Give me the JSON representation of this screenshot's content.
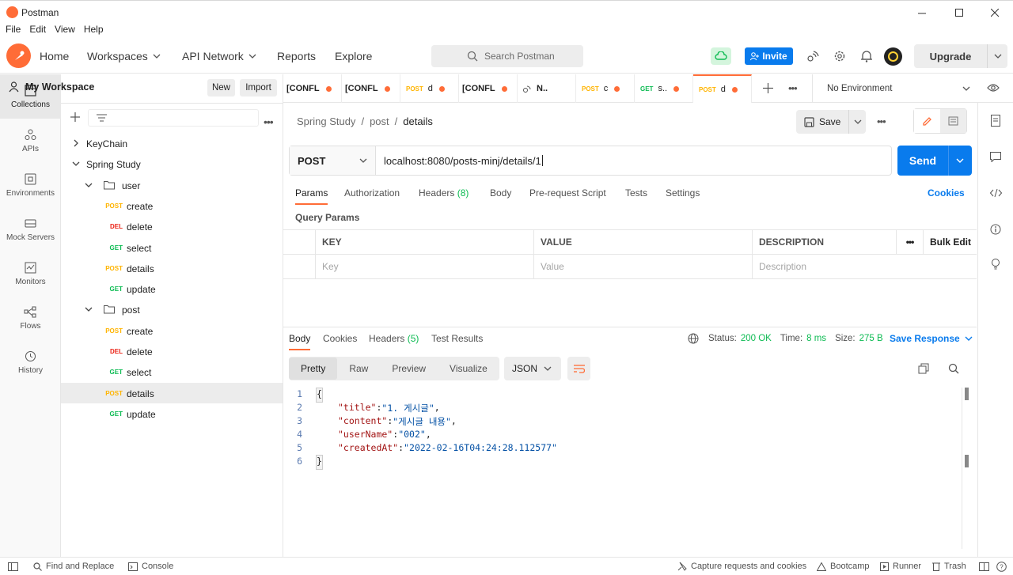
{
  "window": {
    "title": "Postman",
    "controls": [
      "minimize",
      "maximize",
      "close"
    ]
  },
  "menu": [
    "File",
    "Edit",
    "View",
    "Help"
  ],
  "header": {
    "nav": [
      "Home",
      "Workspaces",
      "API Network",
      "Reports",
      "Explore"
    ],
    "search_placeholder": "Search Postman",
    "invite_label": "Invite",
    "upgrade_label": "Upgrade"
  },
  "rail": [
    {
      "label": "Collections",
      "icon": "collections-icon"
    },
    {
      "label": "APIs",
      "icon": "apis-icon"
    },
    {
      "label": "Environments",
      "icon": "environments-icon"
    },
    {
      "label": "Mock Servers",
      "icon": "mock-servers-icon"
    },
    {
      "label": "Monitors",
      "icon": "monitors-icon"
    },
    {
      "label": "Flows",
      "icon": "flows-icon"
    },
    {
      "label": "History",
      "icon": "history-icon"
    }
  ],
  "sidebar": {
    "workspace": "My Workspace",
    "new_label": "New",
    "import_label": "Import",
    "tree": [
      {
        "label": "KeyChain",
        "type": "collection",
        "expanded": false
      },
      {
        "label": "Spring Study",
        "type": "collection",
        "expanded": true
      },
      {
        "label": "user",
        "type": "folder"
      },
      {
        "label": "create",
        "method": "POST"
      },
      {
        "label": "delete",
        "method": "DEL"
      },
      {
        "label": "select",
        "method": "GET"
      },
      {
        "label": "details",
        "method": "POST"
      },
      {
        "label": "update",
        "method": "GET"
      },
      {
        "label": "post",
        "type": "folder"
      },
      {
        "label": "create",
        "method": "POST"
      },
      {
        "label": "delete",
        "method": "DEL"
      },
      {
        "label": "select",
        "method": "GET"
      },
      {
        "label": "details",
        "method": "POST"
      },
      {
        "label": "update",
        "method": "GET"
      }
    ]
  },
  "tabs": [
    {
      "method": "",
      "label": "[CONFL"
    },
    {
      "method": "",
      "label": "[CONFL"
    },
    {
      "method": "POST",
      "label": "d"
    },
    {
      "method": "",
      "label": "[CONFL"
    },
    {
      "method": "",
      "label": "N.."
    },
    {
      "method": "POST",
      "label": "c"
    },
    {
      "method": "GET",
      "label": "s.."
    },
    {
      "method": "POST",
      "label": "d"
    }
  ],
  "environment": "No Environment",
  "request": {
    "breadcrumb": [
      "Spring Study",
      "post",
      "details"
    ],
    "save_label": "Save",
    "method": "POST",
    "url": "localhost:8080/posts-minj/details/1",
    "send_label": "Send",
    "tabs": [
      "Params",
      "Authorization",
      "Headers",
      "Body",
      "Pre-request Script",
      "Tests",
      "Settings"
    ],
    "headers_count": "(8)",
    "cookies_label": "Cookies",
    "query_params_title": "Query Params",
    "table": {
      "headers": [
        "KEY",
        "VALUE",
        "DESCRIPTION"
      ],
      "bulk_edit": "Bulk Edit",
      "placeholders": [
        "Key",
        "Value",
        "Description"
      ]
    }
  },
  "response": {
    "tabs": [
      "Body",
      "Cookies",
      "Headers",
      "Test Results"
    ],
    "headers_count": "(5)",
    "status_label": "Status:",
    "status_value": "200 OK",
    "time_label": "Time:",
    "time_value": "8 ms",
    "size_label": "Size:",
    "size_value": "275 B",
    "save_response": "Save Response",
    "views": [
      "Pretty",
      "Raw",
      "Preview",
      "Visualize"
    ],
    "format": "JSON",
    "body_lines": [
      {
        "n": "1",
        "text": "{"
      },
      {
        "n": "2",
        "key": "\"title\"",
        "value": "\"1. 게시글\"",
        "comma": ","
      },
      {
        "n": "3",
        "key": "\"content\"",
        "value": "\"게시글 내용\"",
        "comma": ","
      },
      {
        "n": "4",
        "key": "\"userName\"",
        "value": "\"002\"",
        "comma": ","
      },
      {
        "n": "5",
        "key": "\"createdAt\"",
        "value": "\"2022-02-16T04:24:28.112577\"",
        "comma": ""
      },
      {
        "n": "6",
        "text": "}"
      }
    ]
  },
  "statusbar": {
    "find_replace": "Find and Replace",
    "console": "Console",
    "capture": "Capture requests and cookies",
    "bootcamp": "Bootcamp",
    "runner": "Runner",
    "trash": "Trash"
  },
  "colors": {
    "accent": "#ff6c37",
    "primary": "#097bed",
    "post": "#ffb400",
    "get": "#0cbb52",
    "del": "#eb2013"
  }
}
